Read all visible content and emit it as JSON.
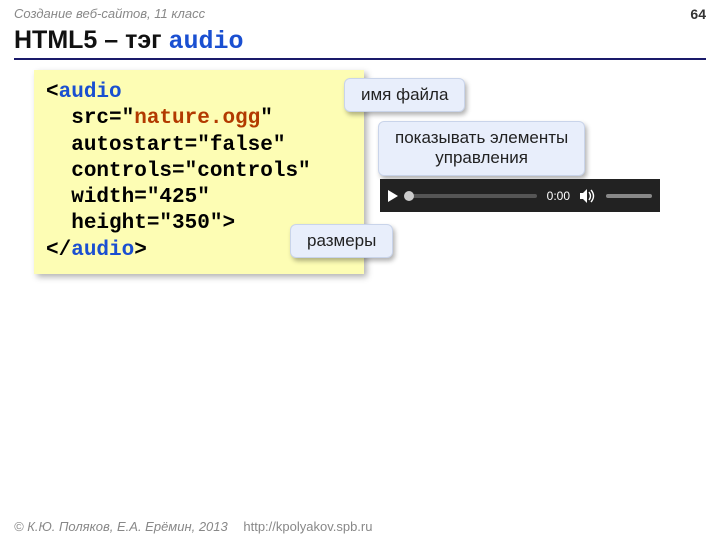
{
  "header": {
    "course": "Создание веб-сайтов, 11 класс",
    "page_number": "64"
  },
  "title": {
    "prefix": "HTML5 – тэг ",
    "tag": "audio"
  },
  "code": {
    "lt": "<",
    "tag_open": "audio",
    "line_src_attr": "src=\"",
    "line_src_val": "nature.ogg",
    "line_src_q": "\"",
    "line_autostart": "autostart=\"false\"",
    "line_controls": "controls=\"controls\"",
    "line_width": "width=\"425\"",
    "line_height": "height=\"350\">",
    "lt2": "</",
    "tag_close": "audio",
    "gt": ">"
  },
  "callouts": {
    "filename": "имя файла",
    "controls_line1": "показывать элементы",
    "controls_line2": "управления",
    "dimensions": "размеры"
  },
  "player": {
    "time": "0:00"
  },
  "footer": {
    "copyright": "© К.Ю. Поляков, Е.А. Ерёмин, 2013",
    "url": "http://kpolyakov.spb.ru"
  }
}
